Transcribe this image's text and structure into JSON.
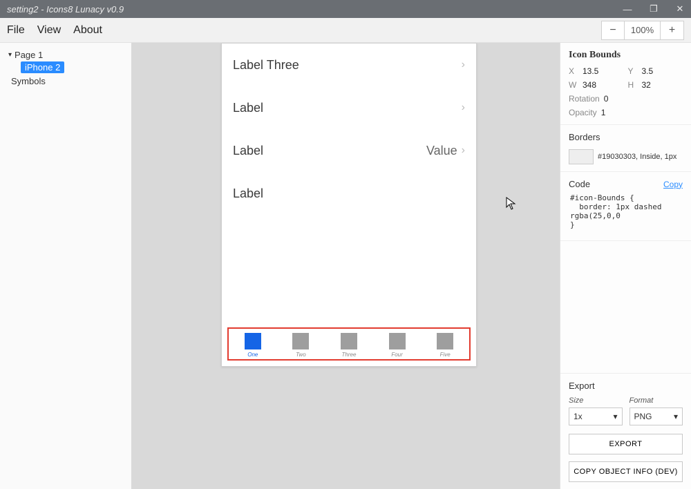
{
  "window": {
    "title": "setting2 - Icons8 Lunacy v0.9"
  },
  "menu": {
    "file": "File",
    "view": "View",
    "about": "About"
  },
  "zoom": {
    "minus": "−",
    "level": "100%",
    "plus": "+"
  },
  "tree": {
    "page": "Page 1",
    "artboard": "iPhone 2",
    "symbols": "Symbols"
  },
  "artboard_rows": [
    {
      "label": "Label Three",
      "value": "",
      "chevron": true
    },
    {
      "label": "Label",
      "value": "",
      "chevron": true
    },
    {
      "label": "Label",
      "value": "Value",
      "chevron": true
    },
    {
      "label": "Label",
      "value": "",
      "chevron": false
    }
  ],
  "tabs": [
    {
      "label": "One",
      "active": true
    },
    {
      "label": "Two",
      "active": false
    },
    {
      "label": "Three",
      "active": false
    },
    {
      "label": "Four",
      "active": false
    },
    {
      "label": "Five",
      "active": false
    }
  ],
  "inspector": {
    "title": "Icon Bounds",
    "x_k": "X",
    "x_v": "13.5",
    "y_k": "Y",
    "y_v": "3.5",
    "w_k": "W",
    "w_v": "348",
    "h_k": "H",
    "h_v": "32",
    "rotation_k": "Rotation",
    "rotation_v": "0",
    "opacity_k": "Opacity",
    "opacity_v": "1",
    "borders_title": "Borders",
    "border_desc": "#19030303, Inside, 1px",
    "code_title": "Code",
    "copy": "Copy",
    "code_text": "#icon-Bounds {\n  border: 1px dashed rgba(25,0,0\n}"
  },
  "export": {
    "title": "Export",
    "size_k": "Size",
    "size_v": "1x",
    "format_k": "Format",
    "format_v": "PNG",
    "export_btn": "EXPORT",
    "copy_btn": "COPY OBJECT INFO (DEV)"
  }
}
